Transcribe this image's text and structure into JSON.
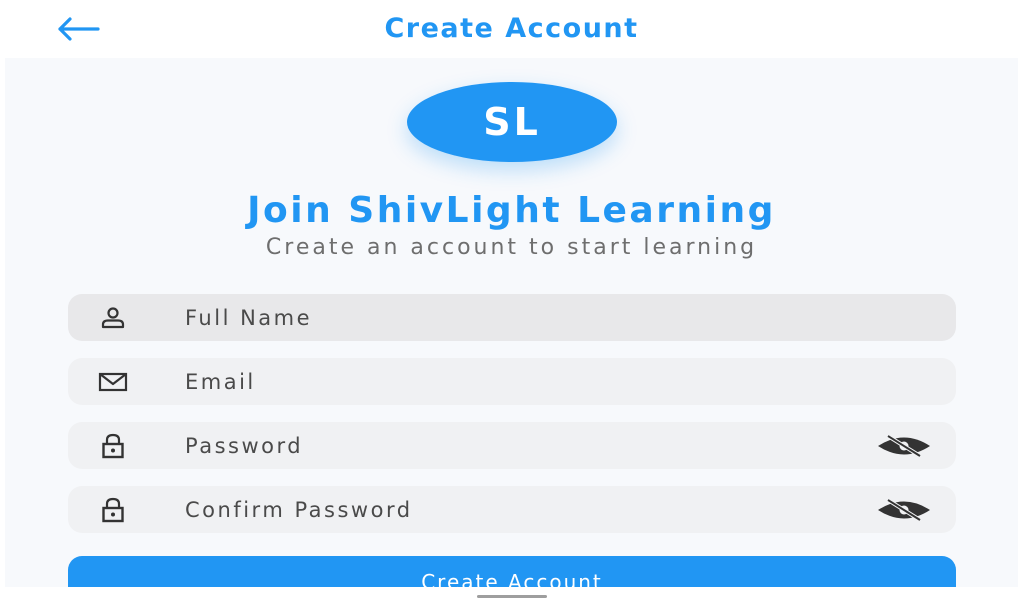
{
  "app_bar": {
    "title": "Create Account",
    "back_icon": "arrow-left-icon"
  },
  "avatar": {
    "initials": "SL"
  },
  "heading": "Join ShivLight Learning",
  "subheading": "Create an account to start learning",
  "form": {
    "full_name": {
      "placeholder": "Full Name",
      "value": "",
      "icon": "person-icon"
    },
    "email": {
      "placeholder": "Email",
      "value": "",
      "icon": "mail-icon"
    },
    "password": {
      "placeholder": "Password",
      "value": "",
      "icon": "lock-icon",
      "toggle_icon": "eye-off-icon"
    },
    "confirm_password": {
      "placeholder": "Confirm Password",
      "value": "",
      "icon": "lock-icon",
      "toggle_icon": "eye-off-icon"
    }
  },
  "submit_label": "Create Account",
  "colors": {
    "primary": "#2196f3",
    "background": "#f7f9fc",
    "field_background": "#f0f1f3",
    "icon": "#333333"
  }
}
